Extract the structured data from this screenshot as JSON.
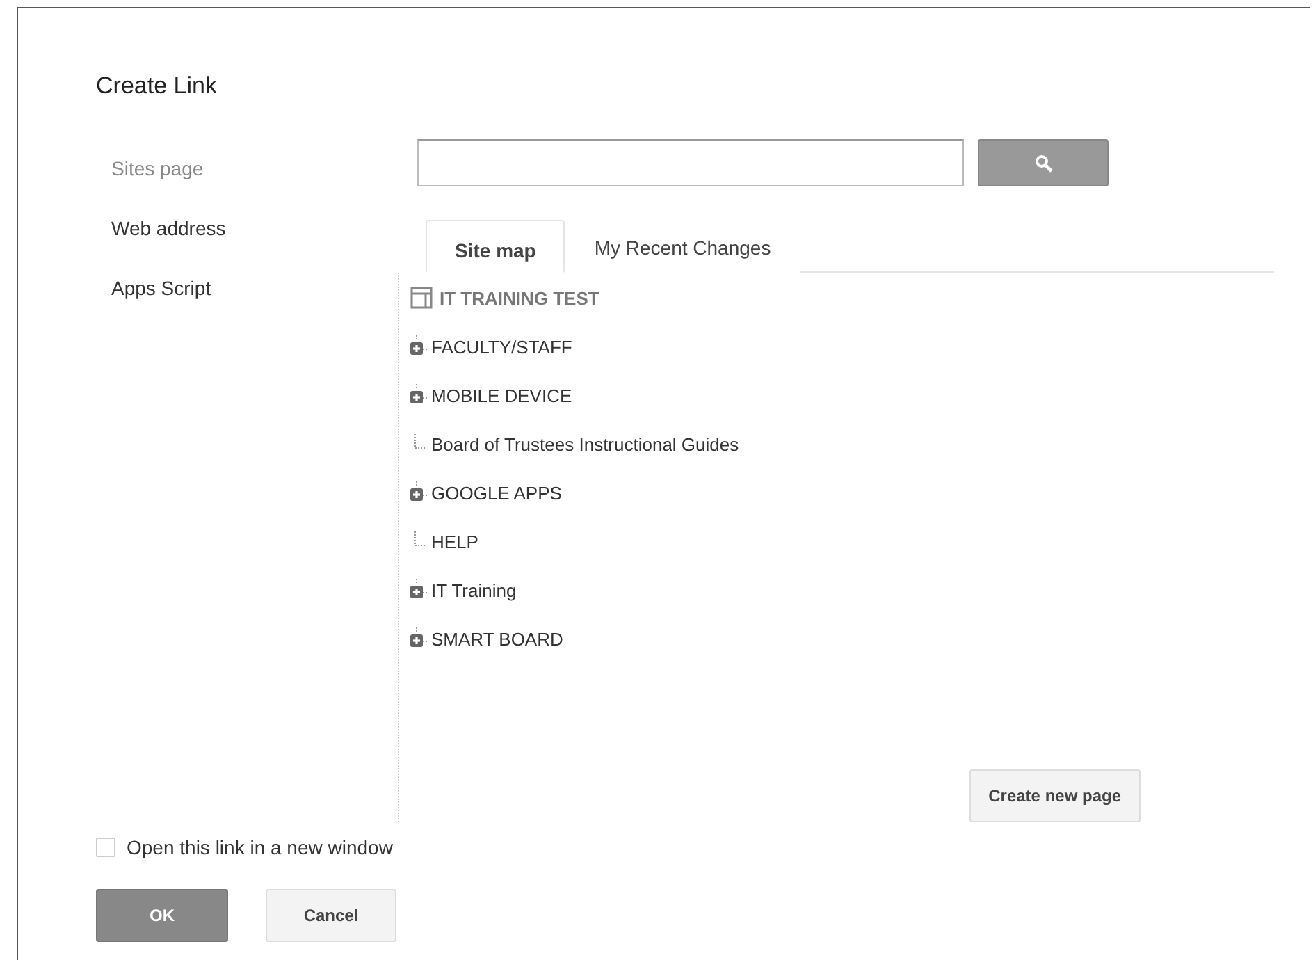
{
  "dialog": {
    "title": "Create Link"
  },
  "nav": [
    {
      "label": "Sites page",
      "selected": true
    },
    {
      "label": "Web address",
      "selected": false
    },
    {
      "label": "Apps Script",
      "selected": false
    }
  ],
  "tabs": [
    {
      "label": "Site map",
      "selected": true
    },
    {
      "label": "My Recent Changes",
      "selected": false
    }
  ],
  "tree": {
    "label": "IT TRAINING TEST",
    "children": [
      {
        "label": "FACULTY/STAFF",
        "kind": "folder"
      },
      {
        "label": "MOBILE DEVICE",
        "kind": "folder"
      },
      {
        "label": "Board of Trustees Instructional Guides",
        "kind": "leaf"
      },
      {
        "label": "GOOGLE APPS",
        "kind": "folder"
      },
      {
        "label": "HELP",
        "kind": "leaf"
      },
      {
        "label": "IT Training",
        "kind": "folder"
      },
      {
        "label": "SMART BOARD",
        "kind": "folder"
      }
    ]
  },
  "create_button": "Create new page",
  "new_window": {
    "label": "Open this link in a new window",
    "checked": false
  },
  "buttons": [
    {
      "label": "OK",
      "kind": "primary"
    },
    {
      "label": "Cancel",
      "kind": "secondary"
    }
  ]
}
